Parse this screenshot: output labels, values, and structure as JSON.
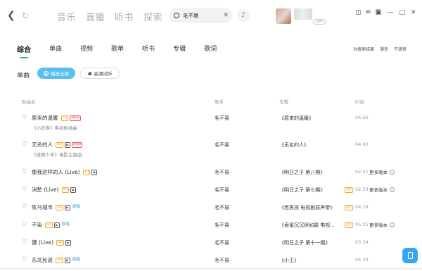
{
  "top_nav": {
    "tabs": [
      "音乐",
      "直播",
      "听书",
      "探索"
    ],
    "search_value": "毛不易",
    "vip_badge": "LV0"
  },
  "category_tabs": [
    "综合",
    "单曲",
    "视频",
    "歌单",
    "听书",
    "专辑",
    "歌词"
  ],
  "active_category": "综合",
  "feedback": {
    "label": "对搜索结果",
    "satisfied": "满意",
    "unsatisfied": "不满意"
  },
  "section": {
    "title": "单曲",
    "play_all": "播放全部",
    "try_listen": "高潮试听"
  },
  "table_headers": {
    "song": "歌曲名",
    "artist": "歌手",
    "album": "专辑",
    "time": "时间"
  },
  "songs": [
    {
      "title": "原来的温暖",
      "tags": [
        "SQ",
        "NEW"
      ],
      "sub": "《小欢喜》电视剧插曲",
      "artist": "毛不易",
      "album": "《原来的温暖》",
      "duration": "04:26",
      "more": ""
    },
    {
      "title": "无名的人",
      "tags": [
        "SQ",
        "MV",
        "NEW"
      ],
      "sub": "《雄狮少年》电影主题曲",
      "artist": "毛不易",
      "album": "《无名的人》",
      "duration": "04:42",
      "more": ""
    },
    {
      "title": "像我这样的人 (Live)",
      "tags": [
        "SQ",
        "VIP",
        "MV"
      ],
      "sub": "",
      "artist": "毛不易",
      "album": "《明日之子 第八期》",
      "duration": "02:51",
      "more": "更多版本"
    },
    {
      "title": "消愁 (Live)",
      "tags": [
        "SQ",
        "VIP",
        "MV"
      ],
      "sub": "",
      "artist": "毛不易",
      "album": "《明日之子 第七期》",
      "duration": "02:59",
      "more": "更多版本"
    },
    {
      "title": "牧马城市",
      "tags": [
        "SQ",
        "VIP",
        "MV",
        "原唱"
      ],
      "sub": "",
      "artist": "毛不易",
      "album": "《老男孩 电视剧原声带》",
      "duration": "04:18",
      "more": ""
    },
    {
      "title": "不染",
      "tags": [
        "SQ",
        "MV",
        "原唱"
      ],
      "sub": "",
      "artist": "毛不易",
      "album": "《香蜜沉沉烬如霜 电视...",
      "duration": "05:25",
      "more": "更多版本"
    },
    {
      "title": "健 (Live)",
      "tags": [
        "SQ",
        "MV"
      ],
      "sub": "",
      "artist": "毛不易",
      "album": "《明日之子 第十一期》",
      "duration": "03:34",
      "more": ""
    },
    {
      "title": "东北民谣",
      "tags": [
        "SQ",
        "MV",
        "原唱"
      ],
      "sub": "",
      "artist": "毛不易",
      "album": "《小王》",
      "duration": "04:39",
      "more": ""
    }
  ]
}
